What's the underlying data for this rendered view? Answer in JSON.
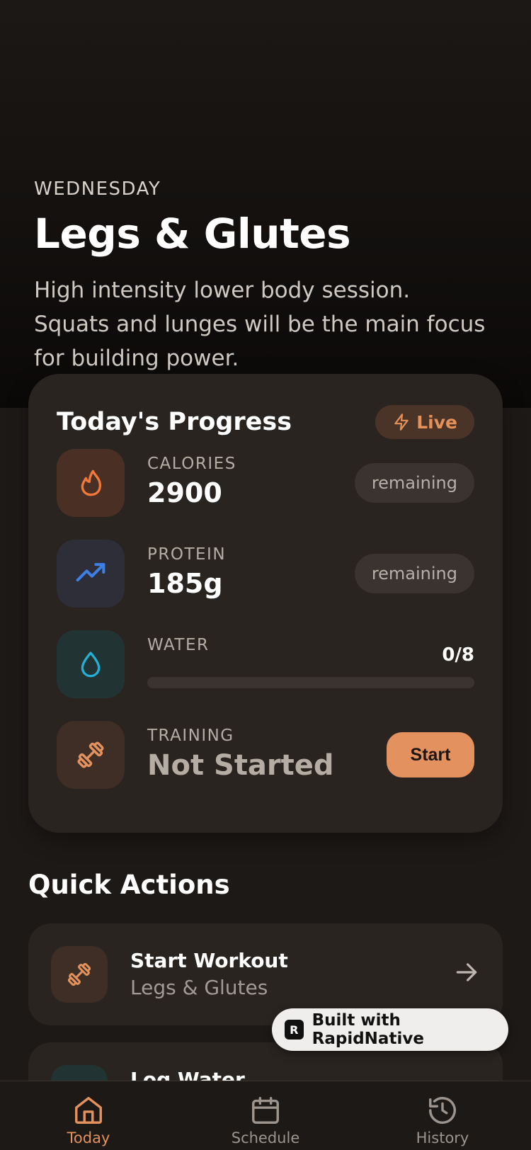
{
  "hero": {
    "day": "WEDNESDAY",
    "title": "Legs & Glutes",
    "description": "High intensity lower body session. Squats and lunges will be the main focus for building power."
  },
  "progress": {
    "title": "Today's Progress",
    "live_label": "Live",
    "calories": {
      "label": "CALORIES",
      "value": "2900",
      "pill": "remaining"
    },
    "protein": {
      "label": "PROTEIN",
      "value": "185g",
      "pill": "remaining"
    },
    "water": {
      "label": "WATER",
      "count": "0/8",
      "fraction": 0
    },
    "training": {
      "label": "TRAINING",
      "value": "Not Started",
      "button": "Start"
    }
  },
  "quick_actions": {
    "title": "Quick Actions",
    "items": [
      {
        "label": "Start Workout",
        "sub": "Legs & Glutes",
        "icon": "dumbbell-icon"
      },
      {
        "label": "Log Water",
        "sub": "",
        "icon": "water-drop-icon"
      }
    ]
  },
  "badge": {
    "label": "Built with RapidNative"
  },
  "tabs": [
    {
      "label": "Today",
      "icon": "home-icon",
      "active": true
    },
    {
      "label": "Schedule",
      "icon": "calendar-icon",
      "active": false
    },
    {
      "label": "History",
      "icon": "history-icon",
      "active": false
    }
  ],
  "colors": {
    "accent": "#e3915e",
    "background": "#1d1917",
    "card": "#2a2421",
    "calories_icon": "#f2793a",
    "protein_icon": "#3d7fe6",
    "water_icon": "#22b0d4"
  }
}
